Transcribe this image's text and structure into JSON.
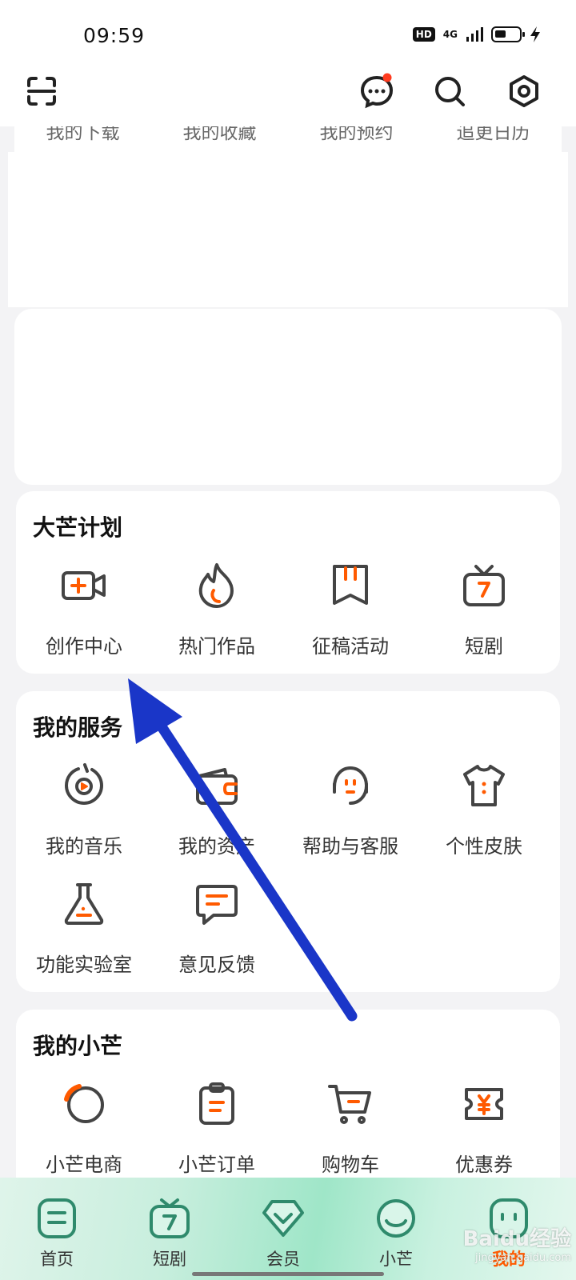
{
  "status_bar": {
    "time": "09:59",
    "hd": "HD",
    "network": "4G"
  },
  "header": {
    "icons": [
      "scan-icon",
      "message-icon",
      "search-icon",
      "settings-icon"
    ]
  },
  "quick_links": [
    "我的下载",
    "我的收藏",
    "我的预约",
    "追更日历"
  ],
  "plan_section": {
    "title": "大芒计划",
    "items": [
      {
        "label": "创作中心",
        "icon": "video-add-icon"
      },
      {
        "label": "热门作品",
        "icon": "flame-icon"
      },
      {
        "label": "征稿活动",
        "icon": "bookmark-icon"
      },
      {
        "label": "短剧",
        "icon": "tv-icon"
      }
    ]
  },
  "services_section": {
    "title": "我的服务",
    "items": [
      {
        "label": "我的音乐",
        "icon": "music-icon"
      },
      {
        "label": "我的资产",
        "icon": "wallet-icon"
      },
      {
        "label": "帮助与客服",
        "icon": "headset-icon"
      },
      {
        "label": "个性皮肤",
        "icon": "shirt-icon"
      },
      {
        "label": "功能实验室",
        "icon": "flask-icon"
      },
      {
        "label": "意见反馈",
        "icon": "feedback-icon"
      }
    ]
  },
  "xiaomang_section": {
    "title": "我的小芒",
    "items": [
      {
        "label": "小芒电商",
        "icon": "circle-icon"
      },
      {
        "label": "小芒订单",
        "icon": "clipboard-icon"
      },
      {
        "label": "购物车",
        "icon": "cart-icon"
      },
      {
        "label": "优惠券",
        "icon": "coupon-icon"
      }
    ]
  },
  "tab_bar": {
    "tabs": [
      {
        "label": "首页",
        "icon": "home-icon"
      },
      {
        "label": "短剧",
        "icon": "short-drama-icon"
      },
      {
        "label": "会员",
        "icon": "vip-diamond-icon"
      },
      {
        "label": "小芒",
        "icon": "xiaomang-icon"
      },
      {
        "label": "我的",
        "icon": "mine-icon",
        "active": true
      }
    ]
  },
  "watermark": {
    "brand": "Baidu经验",
    "url": "jingyan.baidu.com"
  },
  "colors": {
    "accent": "#ff5a00",
    "icon_stroke": "#444444",
    "arrow": "#1a36c8"
  }
}
